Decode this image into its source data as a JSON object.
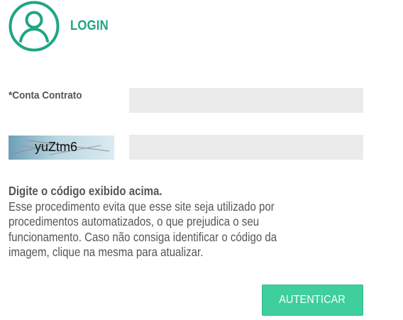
{
  "header": {
    "title": "LOGIN",
    "icon": "user-circle-icon"
  },
  "form": {
    "conta_label": "*Conta Contrato",
    "conta_value": "",
    "captcha_text": "yuZtm6",
    "captcha_value": ""
  },
  "instructions": {
    "heading": "Digite o código exibido acima.",
    "lines": [
      "Esse procedimento evita que esse site seja utilizado por",
      "procedimentos automatizados, o que prejudica o seu",
      "funcionamento. Caso não consiga identificar o código da",
      "imagem, clique na mesma para atualizar."
    ]
  },
  "submit": {
    "label": "AUTENTICAR"
  },
  "colors": {
    "accent": "#1ea583",
    "button": "#3ecf9d",
    "input_bg": "#ebebeb",
    "text": "#555555"
  }
}
